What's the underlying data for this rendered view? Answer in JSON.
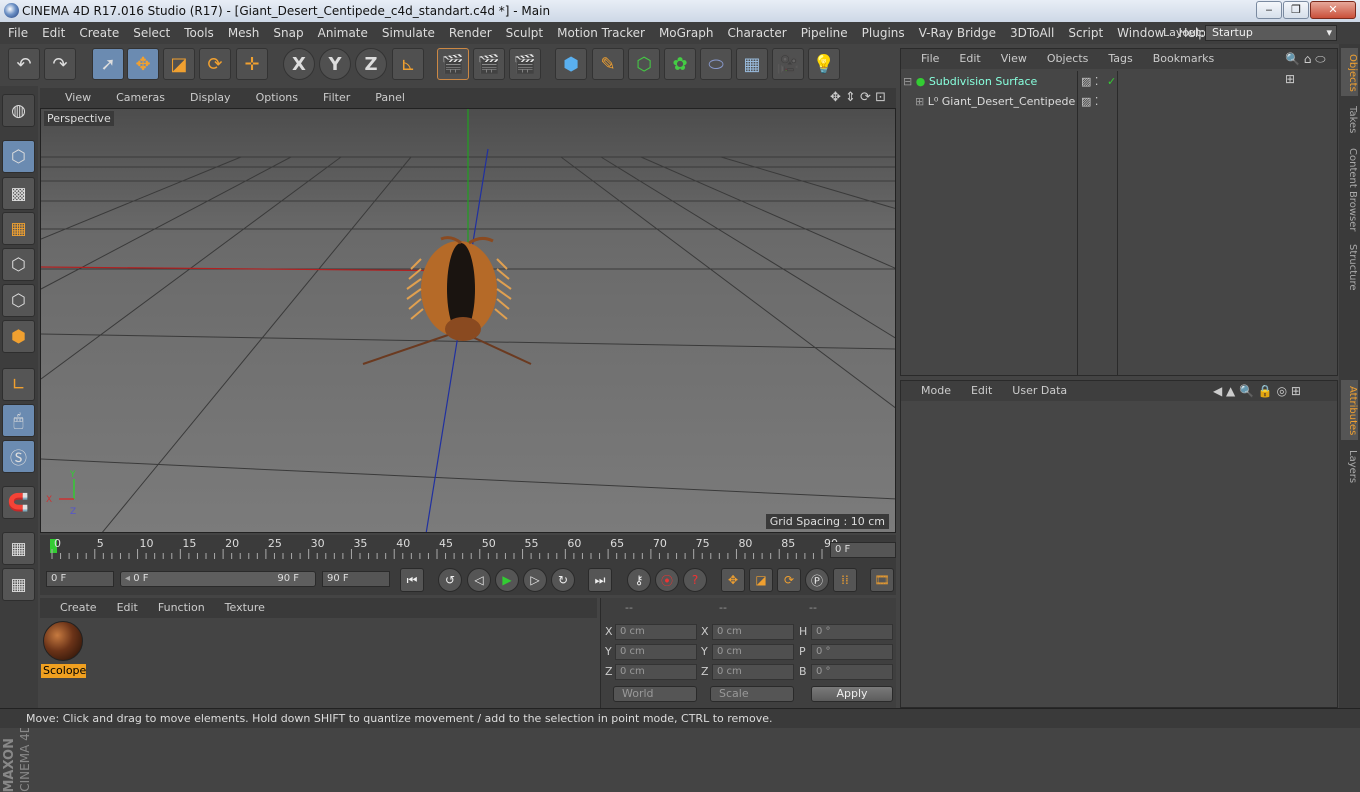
{
  "window": {
    "title": "CINEMA 4D R17.016 Studio (R17) - [Giant_Desert_Centipede_c4d_standart.c4d *] - Main",
    "controls": [
      "‒",
      "❐",
      "✕"
    ]
  },
  "menu": [
    "File",
    "Edit",
    "Create",
    "Select",
    "Tools",
    "Mesh",
    "Snap",
    "Animate",
    "Simulate",
    "Render",
    "Sculpt",
    "Motion Tracker",
    "MoGraph",
    "Character",
    "Pipeline",
    "Plugins",
    "V-Ray Bridge",
    "3DToAll",
    "Script",
    "Window",
    "Help"
  ],
  "layout": {
    "label": "Layout:",
    "value": "Startup"
  },
  "toolbar": {
    "icons": [
      "undo-icon",
      "redo-icon",
      "live-select-icon",
      "move-icon",
      "scale-icon",
      "rotate-icon",
      "move-last-icon",
      "x-axis-icon",
      "y-axis-icon",
      "z-axis-icon",
      "world-coordinates-icon",
      "render-view-icon",
      "render-picture-viewer-icon",
      "edit-render-settings-icon",
      "cube-icon",
      "pen-icon",
      "subdivision-icon",
      "cloner-icon",
      "deformer-icon",
      "floor-icon",
      "camera-icon",
      "light-icon"
    ],
    "glyphs": {
      "undo": "↶",
      "redo": "↷",
      "axis_x": "X",
      "axis_y": "Y",
      "axis_z": "Z"
    }
  },
  "viewport": {
    "menu": [
      "View",
      "Cameras",
      "Display",
      "Options",
      "Filter",
      "Panel"
    ],
    "label": "Perspective",
    "grid_spacing": "Grid Spacing : 10 cm",
    "axis_labels": {
      "x": "X",
      "y": "Y",
      "z": "Z"
    },
    "colors": {
      "x_axis": "#b22020",
      "y_axis": "#20a020",
      "z_axis": "#2030a0"
    }
  },
  "timeline": {
    "ticks": [
      "0",
      "5",
      "10",
      "15",
      "20",
      "25",
      "30",
      "35",
      "40",
      "45",
      "50",
      "55",
      "60",
      "65",
      "70",
      "75",
      "80",
      "85",
      "90"
    ],
    "current_frame": "0 F",
    "start": "0 F",
    "range_start": "0 F",
    "range_end": "90 F",
    "end": "90 F"
  },
  "materials": {
    "menu": [
      "Create",
      "Edit",
      "Function",
      "Texture"
    ],
    "items": [
      {
        "name": "Scolope"
      }
    ]
  },
  "coordinates": {
    "headers": [
      "--",
      "--",
      "--"
    ],
    "position": [
      {
        "axis": "X",
        "value": "0 cm"
      },
      {
        "axis": "Y",
        "value": "0 cm"
      },
      {
        "axis": "Z",
        "value": "0 cm"
      }
    ],
    "size": [
      {
        "axis": "X",
        "value": "0 cm"
      },
      {
        "axis": "Y",
        "value": "0 cm"
      },
      {
        "axis": "Z",
        "value": "0 cm"
      }
    ],
    "rotation": [
      {
        "axis": "H",
        "value": "0 °"
      },
      {
        "axis": "P",
        "value": "0 °"
      },
      {
        "axis": "B",
        "value": "0 °"
      }
    ],
    "mode_world": "World",
    "mode_scale": "Scale",
    "apply_label": "Apply"
  },
  "objects": {
    "menu": [
      "File",
      "Edit",
      "View",
      "Objects",
      "Tags",
      "Bookmarks"
    ],
    "items": [
      {
        "name": "Subdivision Surface"
      },
      {
        "name": "Giant_Desert_Centipede"
      }
    ]
  },
  "attributes": {
    "menu": [
      "Mode",
      "Edit",
      "User Data"
    ]
  },
  "side_tabs": [
    "Objects",
    "Takes",
    "Content Browser",
    "Structure",
    "Attributes",
    "Layers"
  ],
  "brand": {
    "line1": "MAXON",
    "line2": "CINEMA 4D"
  },
  "status": "Move: Click and drag to move elements. Hold down SHIFT to quantize movement / add to the selection in point mode, CTRL to remove."
}
